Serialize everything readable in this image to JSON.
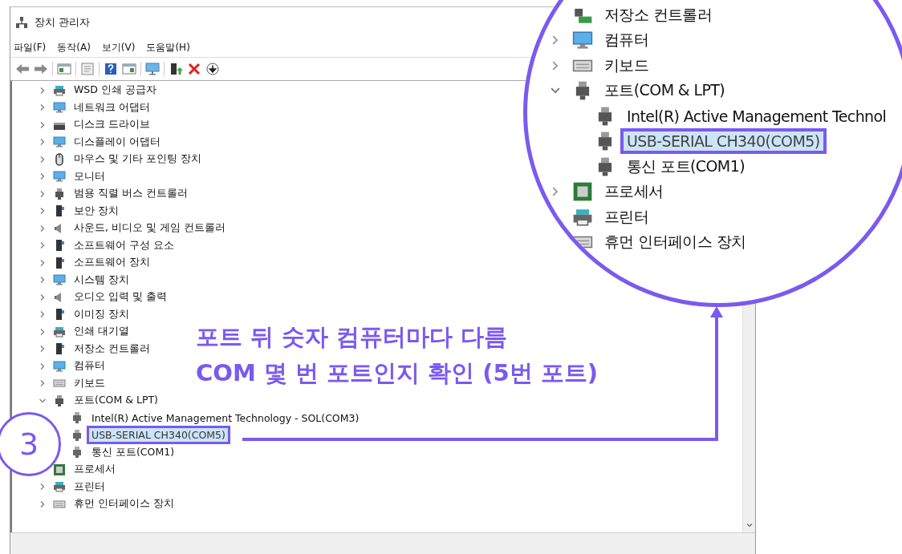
{
  "window": {
    "title": "장치 관리자"
  },
  "menu": [
    {
      "label": "파일(F)"
    },
    {
      "label": "동작(A)"
    },
    {
      "label": "보기(V)"
    },
    {
      "label": "도움말(H)"
    }
  ],
  "tree": [
    {
      "label": "WSD 인쇄 공급자",
      "expanded": false
    },
    {
      "label": "네트워크 어댑터",
      "expanded": false
    },
    {
      "label": "디스크 드라이브",
      "expanded": false
    },
    {
      "label": "디스플레이 어댑터",
      "expanded": false
    },
    {
      "label": "마우스 및 기타 포인팅 장치",
      "expanded": false
    },
    {
      "label": "모니터",
      "expanded": false
    },
    {
      "label": "범용 직렬 버스 컨트롤러",
      "expanded": false
    },
    {
      "label": "보안 장치",
      "expanded": false
    },
    {
      "label": "사운드, 비디오 및 게임 컨트롤러",
      "expanded": false
    },
    {
      "label": "소프트웨어 구성 요소",
      "expanded": false
    },
    {
      "label": "소프트웨어 장치",
      "expanded": false
    },
    {
      "label": "시스템 장치",
      "expanded": false
    },
    {
      "label": "오디오 입력 및 출력",
      "expanded": false
    },
    {
      "label": "이미징 장치",
      "expanded": false
    },
    {
      "label": "인쇄 대기열",
      "expanded": false
    },
    {
      "label": "저장소 컨트롤러",
      "expanded": false
    },
    {
      "label": "컴퓨터",
      "expanded": false
    },
    {
      "label": "키보드",
      "expanded": false
    },
    {
      "label": "포트(COM & LPT)",
      "expanded": true,
      "children": [
        {
          "label": "Intel(R) Active Management Technology - SOL(COM3)",
          "selected": false,
          "highlighted": false
        },
        {
          "label": "USB-SERIAL CH340(COM5)",
          "selected": true,
          "highlighted": true
        },
        {
          "label": "통신 포트(COM1)",
          "selected": false,
          "highlighted": false
        }
      ]
    },
    {
      "label": "프로세서"
    },
    {
      "label": "프린터",
      "expanded": false
    },
    {
      "label": "휴먼 인터페이스 장치",
      "expanded": false
    }
  ],
  "annotation": {
    "lines": [
      "포트 뒤 숫자 컴퓨터마다 다름",
      "COM 몇 번 포트인지 확인 (5번 포트)"
    ]
  },
  "step_badge": "3",
  "magnifier": {
    "items": [
      {
        "kind": "category",
        "label": "저장소 컨트롤러"
      },
      {
        "kind": "category",
        "label": "컴퓨터",
        "expanded": false
      },
      {
        "kind": "category",
        "label": "키보드",
        "expanded": false
      },
      {
        "kind": "category",
        "label": "포트(COM & LPT)",
        "expanded": true
      },
      {
        "kind": "child",
        "label": "Intel(R) Active Management Technol",
        "selected": false,
        "highlighted": false
      },
      {
        "kind": "child",
        "label": "USB-SERIAL CH340(COM5)",
        "selected": true,
        "highlighted": true
      },
      {
        "kind": "child",
        "label": "통신 포트(COM1)",
        "selected": false,
        "highlighted": false
      },
      {
        "kind": "category",
        "label": "프로세서",
        "expanded": false
      },
      {
        "kind": "category",
        "label": "프린터"
      },
      {
        "kind": "category",
        "label": "휴먼 인터페이스 장치"
      }
    ]
  }
}
